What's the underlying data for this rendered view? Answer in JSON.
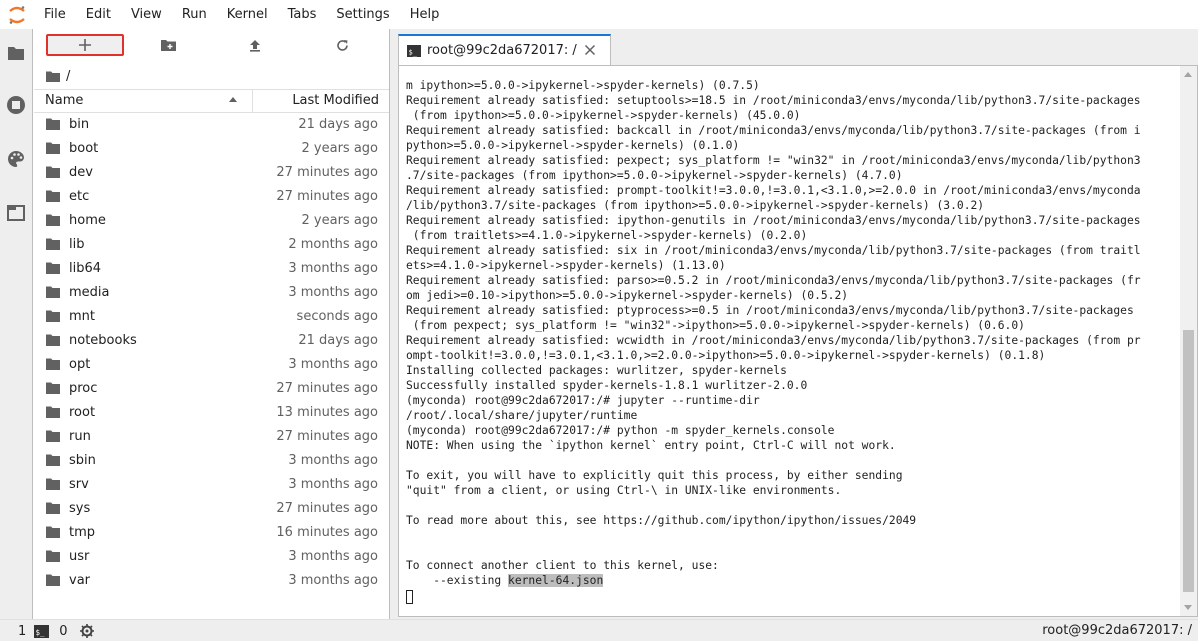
{
  "menubar": {
    "items": [
      "File",
      "Edit",
      "View",
      "Run",
      "Kernel",
      "Tabs",
      "Settings",
      "Help"
    ]
  },
  "colors": {
    "accent": "#1976d2",
    "highlight_box": "#e0312b",
    "logo": "#f37726"
  },
  "filebrowser": {
    "breadcrumb": "/",
    "columns": {
      "name": "Name",
      "modified": "Last Modified"
    },
    "files": [
      {
        "name": "bin",
        "modified": "21 days ago"
      },
      {
        "name": "boot",
        "modified": "2 years ago"
      },
      {
        "name": "dev",
        "modified": "27 minutes ago"
      },
      {
        "name": "etc",
        "modified": "27 minutes ago"
      },
      {
        "name": "home",
        "modified": "2 years ago"
      },
      {
        "name": "lib",
        "modified": "2 months ago"
      },
      {
        "name": "lib64",
        "modified": "3 months ago"
      },
      {
        "name": "media",
        "modified": "3 months ago"
      },
      {
        "name": "mnt",
        "modified": "seconds ago"
      },
      {
        "name": "notebooks",
        "modified": "21 days ago"
      },
      {
        "name": "opt",
        "modified": "3 months ago"
      },
      {
        "name": "proc",
        "modified": "27 minutes ago"
      },
      {
        "name": "root",
        "modified": "13 minutes ago"
      },
      {
        "name": "run",
        "modified": "27 minutes ago"
      },
      {
        "name": "sbin",
        "modified": "3 months ago"
      },
      {
        "name": "srv",
        "modified": "3 months ago"
      },
      {
        "name": "sys",
        "modified": "27 minutes ago"
      },
      {
        "name": "tmp",
        "modified": "16 minutes ago"
      },
      {
        "name": "usr",
        "modified": "3 months ago"
      },
      {
        "name": "var",
        "modified": "3 months ago"
      }
    ]
  },
  "terminal": {
    "tab_title": "root@99c2da672017: /",
    "tab_icon_label": "$_",
    "lines": [
      "m ipython>=5.0.0->ipykernel->spyder-kernels) (0.7.5)",
      "Requirement already satisfied: setuptools>=18.5 in /root/miniconda3/envs/myconda/lib/python3.7/site-packages",
      " (from ipython>=5.0.0->ipykernel->spyder-kernels) (45.0.0)",
      "Requirement already satisfied: backcall in /root/miniconda3/envs/myconda/lib/python3.7/site-packages (from i",
      "python>=5.0.0->ipykernel->spyder-kernels) (0.1.0)",
      "Requirement already satisfied: pexpect; sys_platform != \"win32\" in /root/miniconda3/envs/myconda/lib/python3",
      ".7/site-packages (from ipython>=5.0.0->ipykernel->spyder-kernels) (4.7.0)",
      "Requirement already satisfied: prompt-toolkit!=3.0.0,!=3.0.1,<3.1.0,>=2.0.0 in /root/miniconda3/envs/myconda",
      "/lib/python3.7/site-packages (from ipython>=5.0.0->ipykernel->spyder-kernels) (3.0.2)",
      "Requirement already satisfied: ipython-genutils in /root/miniconda3/envs/myconda/lib/python3.7/site-packages",
      " (from traitlets>=4.1.0->ipykernel->spyder-kernels) (0.2.0)",
      "Requirement already satisfied: six in /root/miniconda3/envs/myconda/lib/python3.7/site-packages (from traitl",
      "ets>=4.1.0->ipykernel->spyder-kernels) (1.13.0)",
      "Requirement already satisfied: parso>=0.5.2 in /root/miniconda3/envs/myconda/lib/python3.7/site-packages (fr",
      "om jedi>=0.10->ipython>=5.0.0->ipykernel->spyder-kernels) (0.5.2)",
      "Requirement already satisfied: ptyprocess>=0.5 in /root/miniconda3/envs/myconda/lib/python3.7/site-packages",
      " (from pexpect; sys_platform != \"win32\"->ipython>=5.0.0->ipykernel->spyder-kernels) (0.6.0)",
      "Requirement already satisfied: wcwidth in /root/miniconda3/envs/myconda/lib/python3.7/site-packages (from pr",
      "ompt-toolkit!=3.0.0,!=3.0.1,<3.1.0,>=2.0.0->ipython>=5.0.0->ipykernel->spyder-kernels) (0.1.8)",
      "Installing collected packages: wurlitzer, spyder-kernels",
      "Successfully installed spyder-kernels-1.8.1 wurlitzer-2.0.0",
      "(myconda) root@99c2da672017:/# jupyter --runtime-dir",
      "/root/.local/share/jupyter/runtime",
      "(myconda) root@99c2da672017:/# python -m spyder_kernels.console",
      "NOTE: When using the `ipython kernel` entry point, Ctrl-C will not work.",
      "",
      "To exit, you will have to explicitly quit this process, by either sending",
      "\"quit\" from a client, or using Ctrl-\\ in UNIX-like environments.",
      "",
      "To read more about this, see https://github.com/ipython/ipython/issues/2049",
      "",
      "",
      "To connect another client to this kernel, use:"
    ],
    "existing_prefix": "    --existing ",
    "existing_file": "kernel-64.json"
  },
  "statusbar": {
    "left_count": "1",
    "terminal_count": "0",
    "right_text": "root@99c2da672017: /"
  }
}
